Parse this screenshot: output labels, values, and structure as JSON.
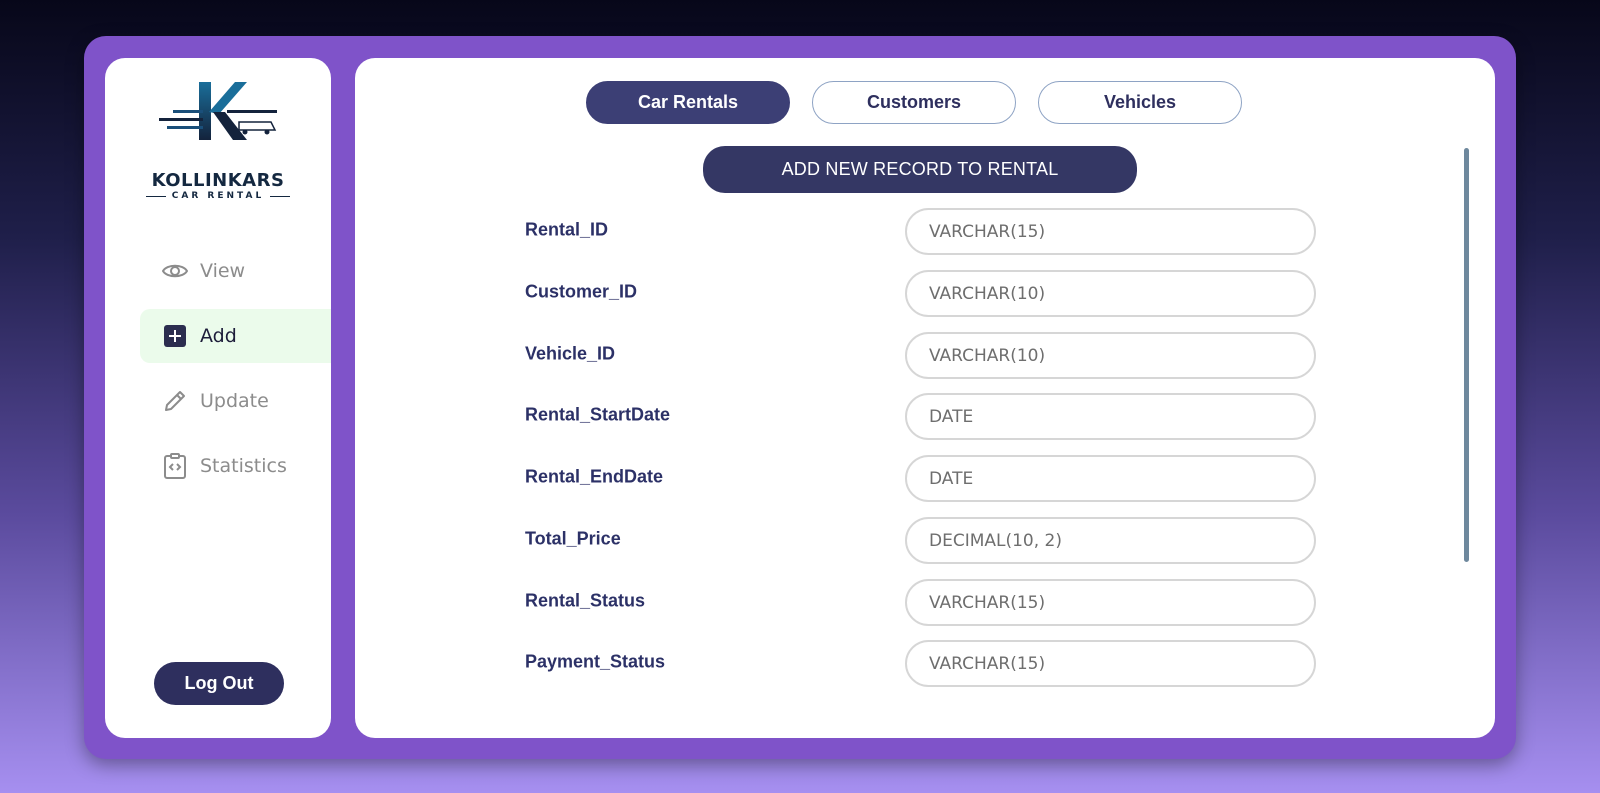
{
  "brand": {
    "name": "KOLLINKARS",
    "subtitle": "CAR RENTAL"
  },
  "sidebar": {
    "items": [
      {
        "label": "View",
        "icon": "eye-icon",
        "active": false
      },
      {
        "label": "Add",
        "icon": "plus-square-icon",
        "active": true
      },
      {
        "label": "Update",
        "icon": "pencil-icon",
        "active": false
      },
      {
        "label": "Statistics",
        "icon": "clipboard-code-icon",
        "active": false
      }
    ],
    "logout_label": "Log Out"
  },
  "tabs": [
    {
      "label": "Car Rentals",
      "active": true
    },
    {
      "label": "Customers",
      "active": false
    },
    {
      "label": "Vehicles",
      "active": false
    }
  ],
  "add_button_label": "ADD NEW RECORD TO RENTAL",
  "fields": [
    {
      "label": "Rental_ID",
      "placeholder": "VARCHAR(15)"
    },
    {
      "label": "Customer_ID",
      "placeholder": "VARCHAR(10)"
    },
    {
      "label": "Vehicle_ID",
      "placeholder": "VARCHAR(10)"
    },
    {
      "label": "Rental_StartDate",
      "placeholder": "DATE"
    },
    {
      "label": "Rental_EndDate",
      "placeholder": "DATE"
    },
    {
      "label": "Total_Price",
      "placeholder": "DECIMAL(10, 2)"
    },
    {
      "label": "Rental_Status",
      "placeholder": "VARCHAR(15)"
    },
    {
      "label": "Payment_Status",
      "placeholder": "VARCHAR(15)"
    }
  ],
  "colors": {
    "accent": "#3c3f75",
    "frame": "#7f53c9",
    "active_nav_bg": "#ebfbeb"
  }
}
